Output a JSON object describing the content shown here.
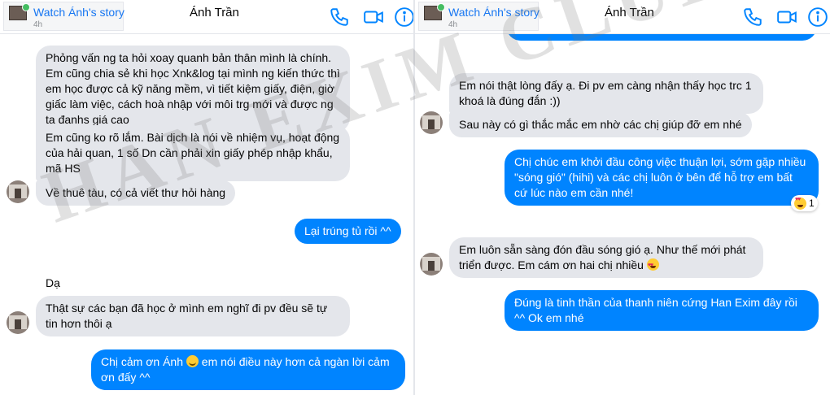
{
  "left": {
    "story": {
      "title": "Watch Ánh's story",
      "sub": "4h"
    },
    "contact": "Ánh Trần",
    "icons": [
      "phone-icon",
      "video-icon",
      "info-icon"
    ],
    "messages": [
      {
        "from": "them",
        "text": "Phỏng vấn ng ta hỏi xoay quanh bản thân mình là chính. Em cũng chia sẻ khi học Xnk&log tại mình ng kiến thức thì em học được cả kỹ năng mềm, vì tiết kiệm giấy, điện, giờ giấc làm việc, cách hoà nhập với môi trg mới và được ng ta đanhs giá cao"
      },
      {
        "from": "them",
        "text": "Em cũng ko rõ lắm. Bài dịch là nói về nhiệm vụ, hoạt động của hải quan, 1 số Dn cần phải xin giấy phép nhập khẩu, mã HS"
      },
      {
        "from": "them",
        "text": "Về thuê tàu, có cả viết thư hỏi hàng"
      },
      {
        "from": "me",
        "text": "Lại trúng tủ rồi ^^"
      },
      {
        "from": "them",
        "text": "Dạ"
      },
      {
        "from": "them",
        "text": "Thật sự các bạn đã học ở mình em nghĩ đi pv đều sẽ tự tin hơn thôi ạ"
      },
      {
        "from": "me",
        "text_before": "Chị cảm ơn Ánh",
        "emoji": "slightly-smiling-face",
        "text_after": " em nói điều này hơn cả ngàn lời cảm ơn đấy ^^"
      }
    ]
  },
  "right": {
    "story": {
      "title": "Watch Ánh's story",
      "sub": "4h"
    },
    "contact": "Ánh Trần",
    "icons": [
      "phone-icon",
      "video-icon",
      "info-icon"
    ],
    "messages": [
      {
        "from": "them",
        "text": "Em nói thật lòng đấy ạ. Đi pv em càng nhận thấy học trc 1 khoá là đúng đắn :))"
      },
      {
        "from": "them",
        "text": "Sau này có gì thắc mắc em nhờ các chị giúp đỡ em nhé"
      },
      {
        "from": "me",
        "text": "Chị chúc em khởi đầu công việc thuận lợi, sớm gặp nhiều \"sóng gió\" (hihi) và các chị luôn ở bên để hỗ trợ em bất cứ lúc nào em cần nhé!",
        "reaction": {
          "emoji": "heart-eyes",
          "count": "1"
        }
      },
      {
        "from": "them",
        "text_before": "Em luôn sẵn sàng đón đầu sóng gió ạ. Như thế mới phát triển được. Em cám ơn hai chị nhiều ",
        "emoji": "heart-eyes"
      },
      {
        "from": "me",
        "text": "Đúng là tinh thần của thanh niên cứng Han Exim đây rồi ^^ Ok em nhé"
      }
    ]
  },
  "watermark": "HAN EXIM CLUB",
  "colors": {
    "outgoing": "#0084ff",
    "incoming": "#e4e6eb",
    "accent": "#1877f2"
  }
}
